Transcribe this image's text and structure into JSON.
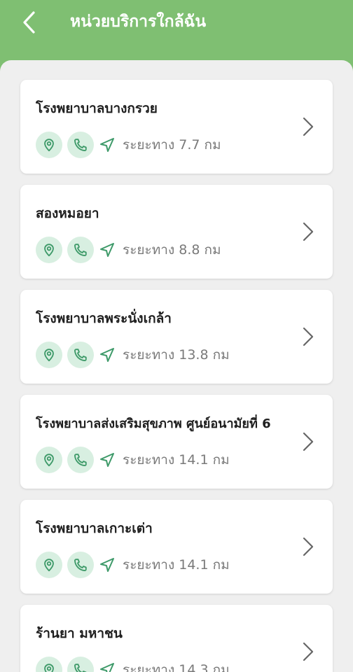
{
  "header": {
    "title": "หน่วยบริการใกล้ฉัน",
    "back_icon": "chevron-left-icon"
  },
  "colors": {
    "header_bg": "#7fbf72",
    "content_bg": "#efefef",
    "icon_bg": "#d8efe1",
    "icon_fg": "#3e9a69"
  },
  "distance_label": "ระยะทาง",
  "distance_unit": "กม",
  "services": [
    {
      "name": "โรงพยาบาลบางกรวย",
      "distance": "ระยะทาง 7.7 กม"
    },
    {
      "name": "สองหมอยา",
      "distance": "ระยะทาง 8.8 กม"
    },
    {
      "name": "โรงพยาบาลพระนั่งเกล้า",
      "distance": "ระยะทาง 13.8 กม"
    },
    {
      "name": "โรงพยาบาลส่งเสริมสุขภาพ ศูนย์อนามัยที่ 6",
      "distance": "ระยะทาง 14.1 กม"
    },
    {
      "name": "โรงพยาบาลเกาะเต่า",
      "distance": "ระยะทาง 14.1 กม"
    },
    {
      "name": "ร้านยา มหาชน",
      "distance": "ระยะทาง 14.3 กม"
    }
  ]
}
